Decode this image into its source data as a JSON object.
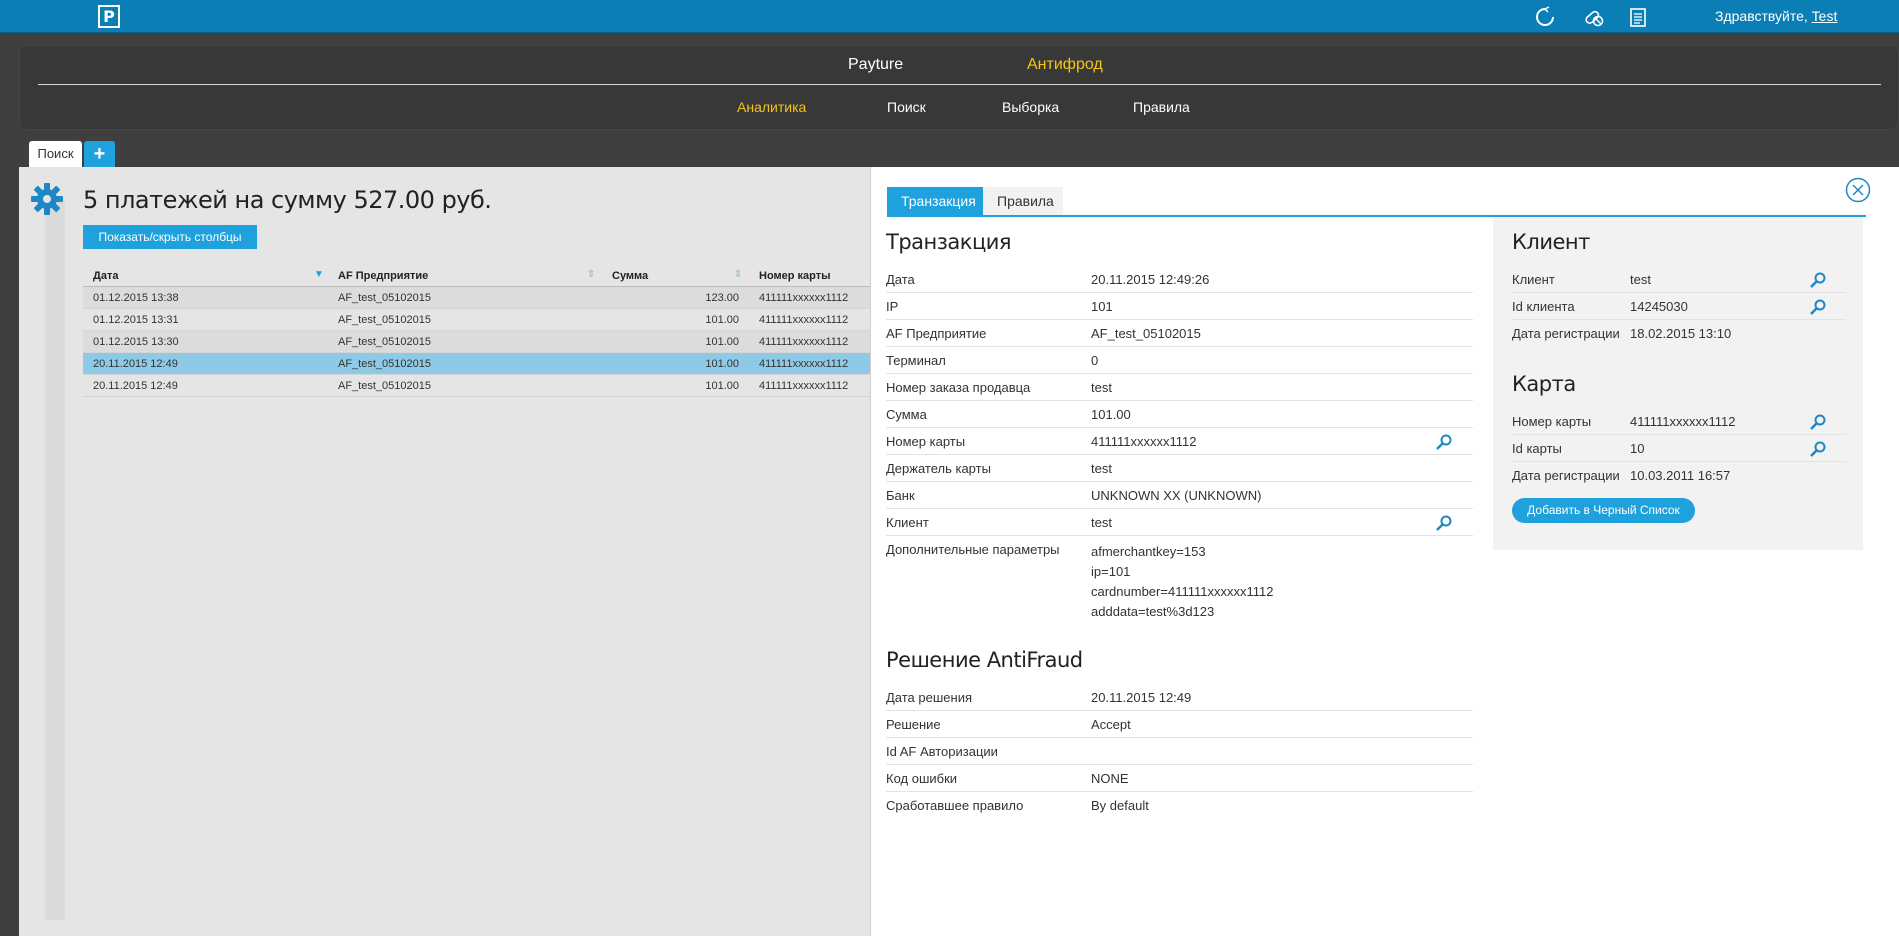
{
  "topbar": {
    "logo": "P",
    "greeting": "Здравствуйте,",
    "user": "Test",
    "icons": [
      "refresh-icon",
      "pills-icon",
      "clipboard-icon"
    ]
  },
  "nav": {
    "main": [
      {
        "label": "Payture",
        "active": false
      },
      {
        "label": "Антифрод",
        "active": true
      }
    ],
    "sub": [
      {
        "label": "Аналитика",
        "active": true
      },
      {
        "label": "Поиск",
        "active": false
      },
      {
        "label": "Выборка",
        "active": false
      },
      {
        "label": "Правила",
        "active": false
      }
    ]
  },
  "tabs": {
    "search_tab": "Поиск",
    "add_tab": "+"
  },
  "results": {
    "title": "5 платежей на сумму 527.00 руб.",
    "toggle_columns_button": "Показать/скрыть столбцы",
    "columns": [
      "Дата",
      "AF Предприятие",
      "Сумма",
      "Номер карты"
    ],
    "rows": [
      {
        "date": "01.12.2015 13:38",
        "merchant": "AF_test_05102015",
        "amount": "123.00",
        "card": "411111xxxxxx1112",
        "selected": false
      },
      {
        "date": "01.12.2015 13:31",
        "merchant": "AF_test_05102015",
        "amount": "101.00",
        "card": "411111xxxxxx1112",
        "selected": false
      },
      {
        "date": "01.12.2015 13:30",
        "merchant": "AF_test_05102015",
        "amount": "101.00",
        "card": "411111xxxxxx1112",
        "selected": false
      },
      {
        "date": "20.11.2015 12:49",
        "merchant": "AF_test_05102015",
        "amount": "101.00",
        "card": "411111xxxxxx1112",
        "selected": true
      },
      {
        "date": "20.11.2015 12:49",
        "merchant": "AF_test_05102015",
        "amount": "101.00",
        "card": "411111xxxxxx1112",
        "selected": false
      }
    ]
  },
  "detail": {
    "tabs": [
      {
        "label": "Транзакция",
        "active": true
      },
      {
        "label": "Правила",
        "active": false
      }
    ],
    "transaction": {
      "title": "Транзакция",
      "fields": [
        {
          "key": "Дата",
          "value": "20.11.2015 12:49:26"
        },
        {
          "key": "IP",
          "value": "101"
        },
        {
          "key": "AF Предприятие",
          "value": "AF_test_05102015"
        },
        {
          "key": "Терминал",
          "value": "0"
        },
        {
          "key": "Номер заказа продавца",
          "value": "test"
        },
        {
          "key": "Сумма",
          "value": "101.00"
        },
        {
          "key": "Номер карты",
          "value": "411111xxxxxx1112"
        },
        {
          "key": "Держатель карты",
          "value": "test"
        },
        {
          "key": "Банк",
          "value": "UNKNOWN XX (UNKNOWN)"
        },
        {
          "key": "Клиент",
          "value": "test"
        }
      ],
      "extra_key": "Дополнительные параметры",
      "extra_values": [
        "afmerchantkey=153",
        "ip=101",
        "cardnumber=411111xxxxxx1112",
        "adddata=test%3d123"
      ]
    },
    "antifraud": {
      "title": "Решение AntiFraud",
      "fields": [
        {
          "key": "Дата решения",
          "value": "20.11.2015 12:49"
        },
        {
          "key": "Решение",
          "value": "Accept"
        },
        {
          "key": "Id AF Авторизации",
          "value": ""
        },
        {
          "key": "Код ошибки",
          "value": "NONE"
        },
        {
          "key": "Сработавшее правило",
          "value": "By default"
        }
      ]
    },
    "client": {
      "title": "Клиент",
      "fields": [
        {
          "key": "Клиент",
          "value": "test"
        },
        {
          "key": "Id клиента",
          "value": "14245030"
        },
        {
          "key": "Дата регистрации",
          "value": "18.02.2015 13:10"
        }
      ]
    },
    "card": {
      "title": "Карта",
      "fields": [
        {
          "key": "Номер карты",
          "value": "411111xxxxxx1112"
        },
        {
          "key": "Id карты",
          "value": "10"
        },
        {
          "key": "Дата регистрации",
          "value": "10.03.2011 16:57"
        }
      ],
      "blacklist_button": "Добавить в Черный Список"
    }
  },
  "colors": {
    "accent": "#1ea1dc",
    "topbar": "#0b7fb5",
    "active_nav": "#f5c518",
    "selected_row": "#8ecae6"
  }
}
